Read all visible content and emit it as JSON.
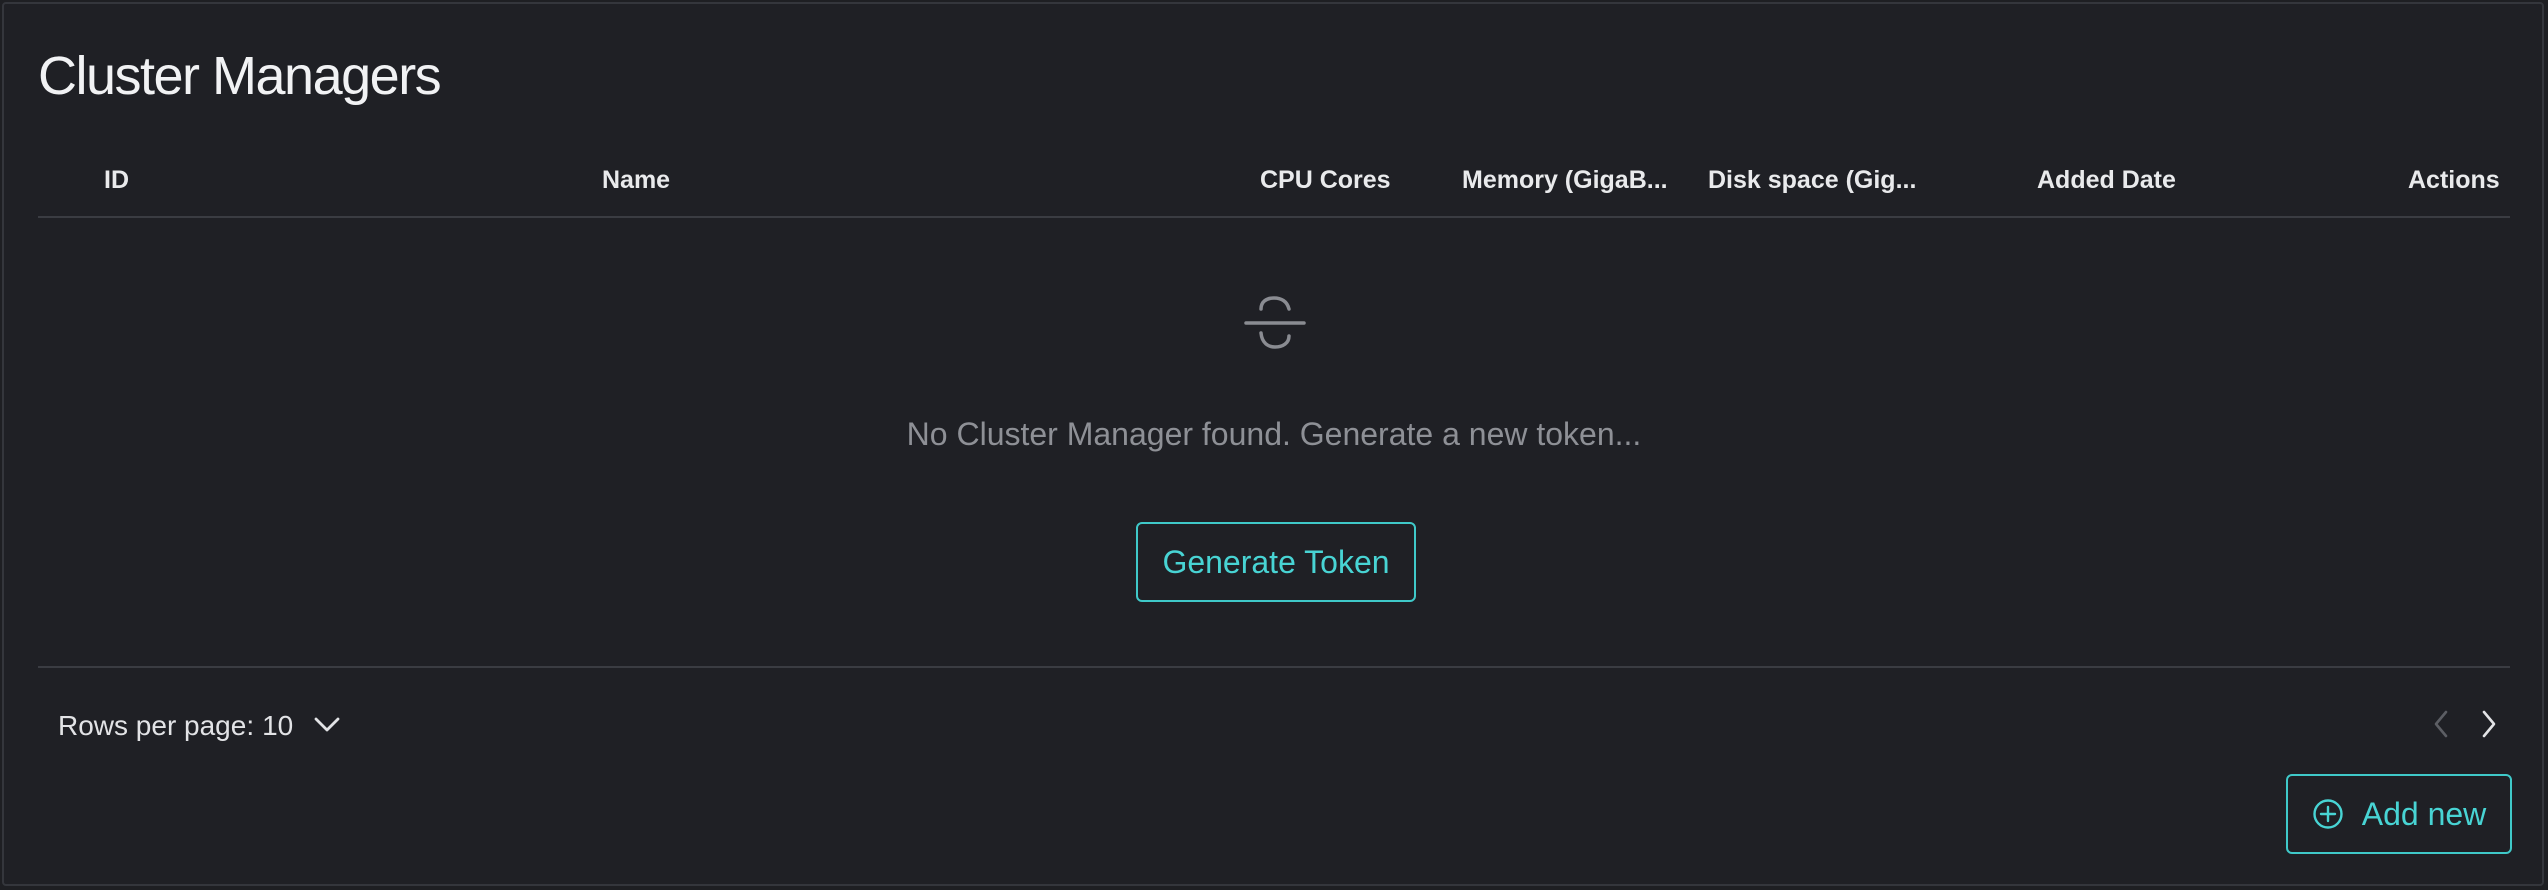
{
  "title": "Cluster Managers",
  "table": {
    "columns": [
      {
        "label": "ID"
      },
      {
        "label": "Name"
      },
      {
        "label": "CPU Cores"
      },
      {
        "label": "Memory (GigaB..."
      },
      {
        "label": "Disk space (Gig..."
      },
      {
        "label": "Added Date"
      },
      {
        "label": "Actions"
      }
    ],
    "rows": []
  },
  "empty_state": {
    "icon": "empty-strikethrough-icon",
    "message": "No Cluster Manager found. Generate a new token...",
    "button_label": "Generate Token"
  },
  "pagination": {
    "rows_per_page_label": "Rows per page:",
    "rows_per_page_value": "10",
    "dropdown_icon": "chevron-down-icon",
    "prev_icon": "chevron-left-icon",
    "next_icon": "chevron-right-icon"
  },
  "add_button": {
    "icon": "plus-circle-icon",
    "label": "Add new"
  },
  "colors": {
    "background": "#1f2025",
    "accent": "#48d4d4",
    "border": "#3a3c42",
    "muted_text": "#8e9096"
  }
}
